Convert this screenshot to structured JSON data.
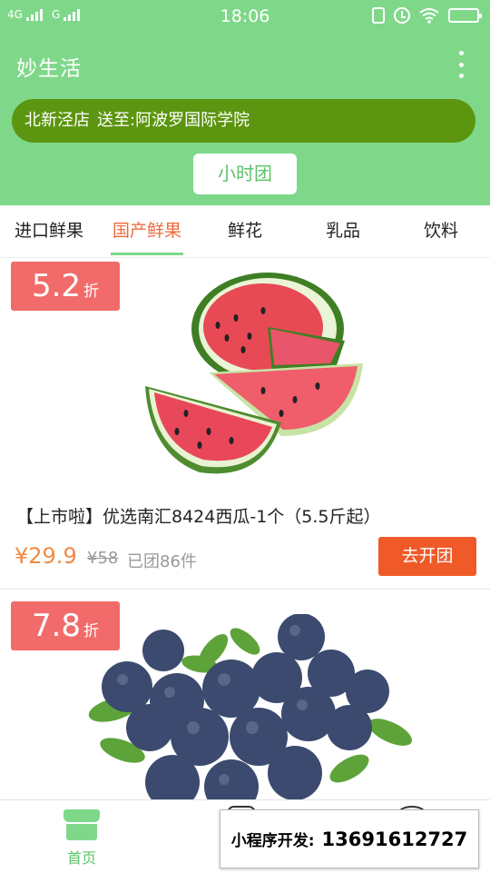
{
  "status_bar": {
    "network1": "4G",
    "network2": "G",
    "time": "18:06"
  },
  "header": {
    "title": "妙生活",
    "store": "北新泾店",
    "deliver_to": "送至:阿波罗国际学院",
    "group_button": "小时团"
  },
  "tabs": [
    {
      "label": "进口鲜果",
      "active": false
    },
    {
      "label": "国产鲜果",
      "active": true
    },
    {
      "label": "鲜花",
      "active": false
    },
    {
      "label": "乳品",
      "active": false
    },
    {
      "label": "饮料",
      "active": false
    }
  ],
  "products": [
    {
      "discount": "5.2",
      "discount_unit": "折",
      "title": "【上市啦】优选南汇8424西瓜-1个（5.5斤起）",
      "price": "¥29.9",
      "original_price": "¥58",
      "sold": "已团86件",
      "button": "去开团",
      "image": "watermelon"
    },
    {
      "discount": "7.8",
      "discount_unit": "折",
      "image": "blueberries"
    }
  ],
  "bottom_nav": {
    "home_label": "首页"
  },
  "promo": {
    "label": "小程序开发:",
    "phone": "13691612727"
  },
  "colors": {
    "header_green": "#7fd88a",
    "store_bar": "#5c950f",
    "accent_orange": "#f05a28",
    "discount_red": "#f26b6b"
  }
}
